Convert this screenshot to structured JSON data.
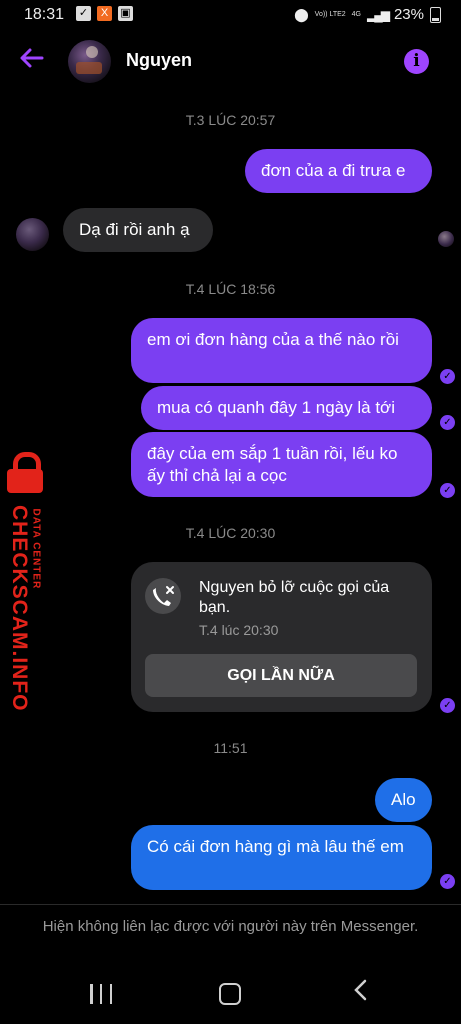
{
  "status_bar": {
    "time": "18:31",
    "network": "Vo)) LTE2",
    "network_type": "4G",
    "battery": "23%"
  },
  "header": {
    "contact_name": "Nguyen",
    "back_icon": "arrow-left-icon",
    "info_icon": "info-icon",
    "accent_color": "#9f45ff"
  },
  "messages": {
    "time_1": "T.3 LÚC 20:57",
    "out_1": "đơn của a đi trưa e",
    "in_1": "Dạ đi rồi anh ạ",
    "time_2": "T.4 LÚC 18:56",
    "out_2": "em ơi đơn hàng của a thế nào rồi",
    "out_3": "mua có quanh đây 1 ngày là tới",
    "out_4": "đây của em sắp 1 tuần rồi, lếu ko ấy thỉ chả lại a cọc",
    "time_3": "T.4 LÚC 20:30",
    "time_4": "11:51",
    "out_5": "Alo",
    "out_6": "Có cái đơn hàng gì mà lâu thế em"
  },
  "call_card": {
    "text": "Nguyen bỏ lỡ cuộc gọi của bạn.",
    "time": "T.4 lúc 20:30",
    "button_label": "GỌI LẦN NỮA",
    "icon": "missed-call-icon"
  },
  "footer": {
    "note": "Hiện không liên lạc được với người này trên Messenger."
  },
  "watermark": {
    "main": "CHECKSCAM.INFO",
    "sub": "DATA CENTER"
  },
  "colors": {
    "outgoing_purple": "#7b3ff2",
    "outgoing_blue": "#1f6fe8",
    "incoming": "#2a2a2c"
  }
}
